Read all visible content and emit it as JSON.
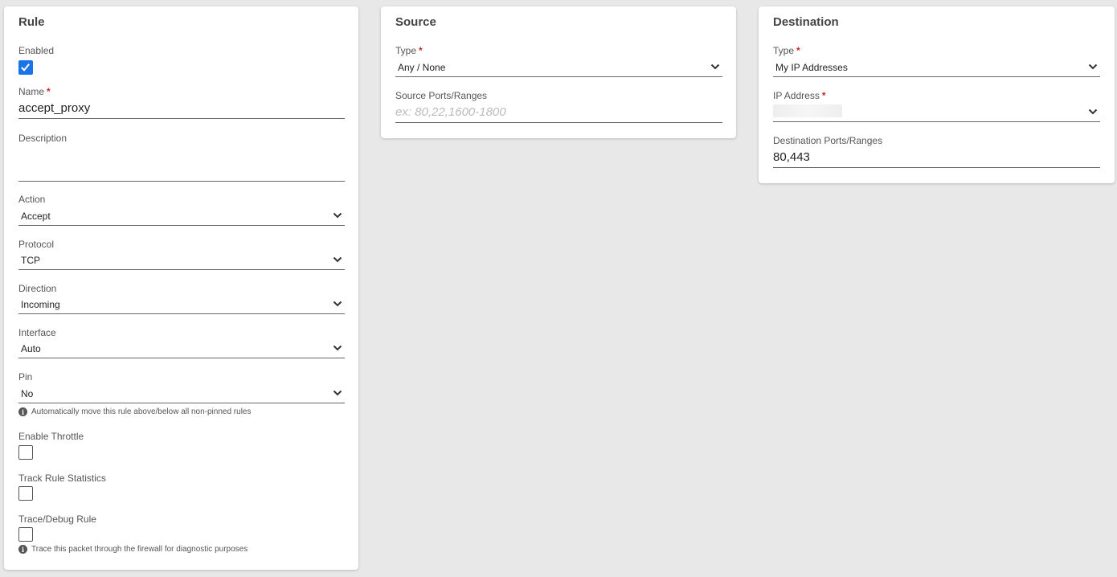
{
  "rule": {
    "title": "Rule",
    "enabled": {
      "label": "Enabled",
      "checked": true
    },
    "name": {
      "label": "Name",
      "value": "accept_proxy"
    },
    "description": {
      "label": "Description",
      "value": ""
    },
    "action": {
      "label": "Action",
      "value": "Accept"
    },
    "protocol": {
      "label": "Protocol",
      "value": "TCP"
    },
    "direction": {
      "label": "Direction",
      "value": "Incoming"
    },
    "interface": {
      "label": "Interface",
      "value": "Auto"
    },
    "pin": {
      "label": "Pin",
      "value": "No",
      "hint": "Automatically move this rule above/below all non-pinned rules"
    },
    "throttle": {
      "label": "Enable Throttle",
      "checked": false
    },
    "statistics": {
      "label": "Track Rule Statistics",
      "checked": false
    },
    "trace": {
      "label": "Trace/Debug Rule",
      "checked": false,
      "hint": "Trace this packet through the firewall for diagnostic purposes"
    }
  },
  "source": {
    "title": "Source",
    "type": {
      "label": "Type",
      "value": "Any / None"
    },
    "ports": {
      "label": "Source Ports/Ranges",
      "placeholder": "ex: 80,22,1600-1800",
      "value": ""
    }
  },
  "destination": {
    "title": "Destination",
    "type": {
      "label": "Type",
      "value": "My IP Addresses"
    },
    "ip": {
      "label": "IP Address",
      "value": ""
    },
    "ports": {
      "label": "Destination Ports/Ranges",
      "value": "80,443"
    }
  },
  "required_marker": "*",
  "info_icon_glyph": "i",
  "colors": {
    "accent": "#1a73e8",
    "required": "#c62828",
    "background": "#e8e8e8"
  }
}
